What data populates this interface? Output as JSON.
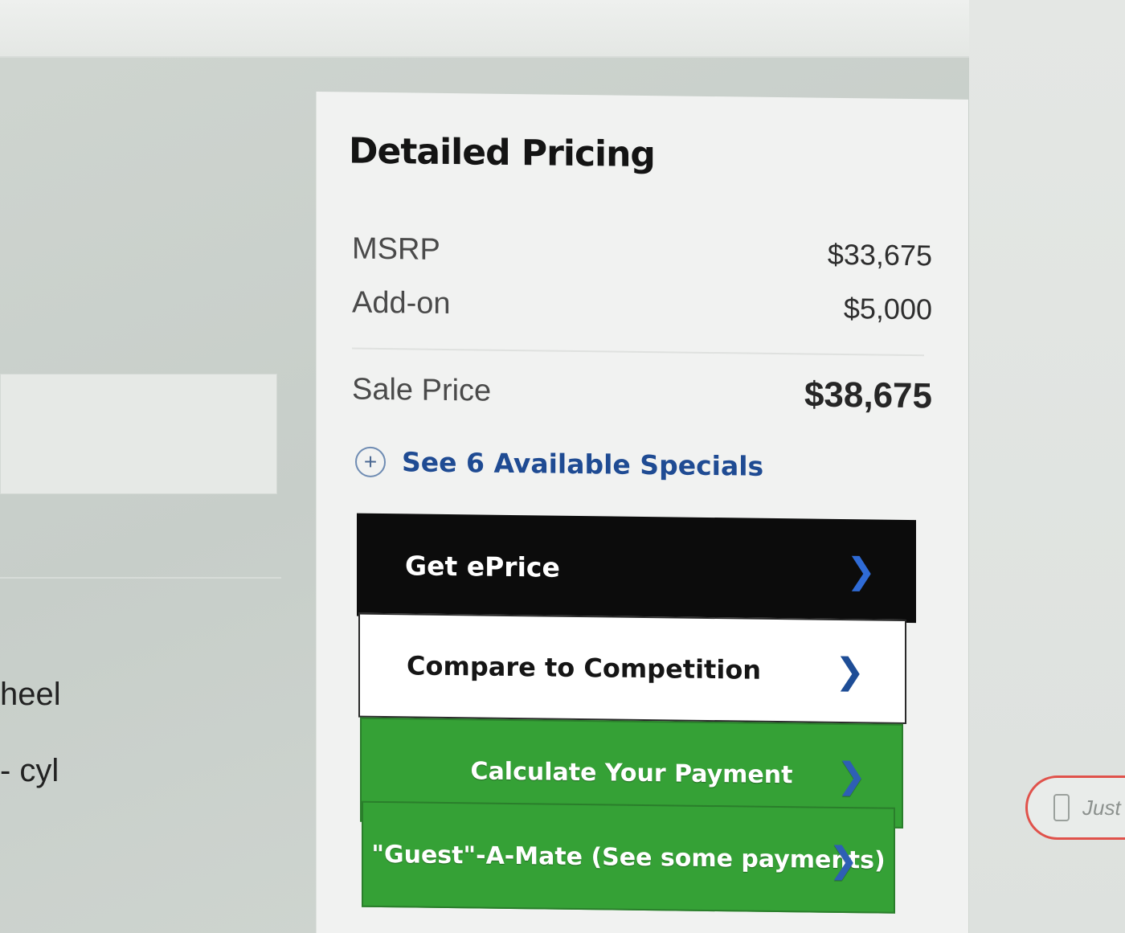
{
  "background": {
    "left_text_1": "heel",
    "left_text_2": "- cyl"
  },
  "pricing": {
    "title": "Detailed Pricing",
    "msrp_label": "MSRP",
    "msrp_value": "$33,675",
    "addon_label": "Add-on",
    "addon_value": "$5,000",
    "sale_label": "Sale Price",
    "sale_value": "$38,675",
    "specials_text": "See 6 Available Specials",
    "specials_icon": "plus-circle-icon"
  },
  "buttons": {
    "eprice": "Get ePrice",
    "compare": "Compare to Competition",
    "calculate": "Calculate Your Payment",
    "guest": "\"Guest\"-A-Mate (See some payments)",
    "chevron": "chevron-right-icon"
  },
  "side_widget": {
    "label": "Just",
    "icon": "phone-icon"
  },
  "colors": {
    "black_button": "#0c0c0c",
    "green_button": "#35a136",
    "link_blue": "#1f4b93",
    "pill_border": "#e0524b"
  }
}
